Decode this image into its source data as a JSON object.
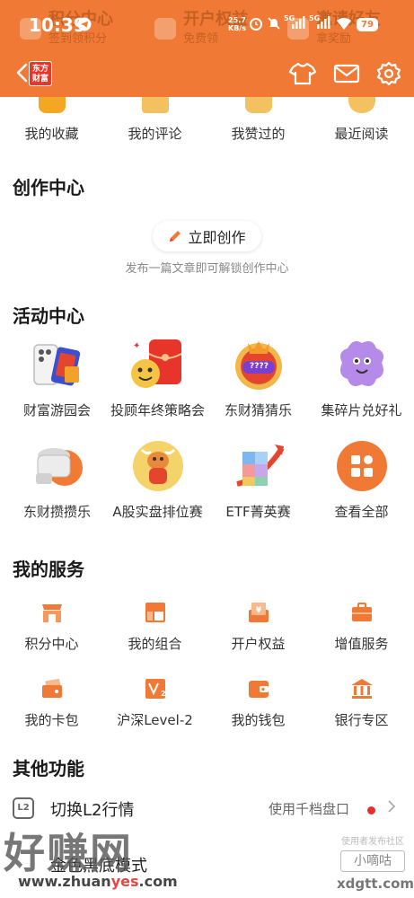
{
  "header": {
    "ghost": [
      {
        "title": "积分中心",
        "sub": "签到领积分"
      },
      {
        "title": "开户权益",
        "sub": "免费领"
      },
      {
        "title": "邀请好友",
        "sub": "拿奖励"
      }
    ],
    "status": {
      "time": "10:39",
      "speed_top": "25.7",
      "speed_bottom": "KB/s",
      "network_1": "5G",
      "network_2": "5G",
      "battery": "79"
    },
    "logo_text_1": "东方",
    "logo_text_2": "财富",
    "accent_color": "#f07a35"
  },
  "quick": [
    {
      "label": "我的收藏",
      "icon": "star-icon"
    },
    {
      "label": "我的评论",
      "icon": "comment-icon"
    },
    {
      "label": "我赞过的",
      "icon": "thumb-up-icon"
    },
    {
      "label": "最近阅读",
      "icon": "clock-icon"
    }
  ],
  "creation": {
    "title": "创作中心",
    "button": "立即创作",
    "note": "发布一篇文章即可解锁创作中心"
  },
  "activities": {
    "title": "活动中心",
    "items": [
      {
        "label": "财富游园会"
      },
      {
        "label": "投顾年终策略会"
      },
      {
        "label": "东财猜猜乐",
        "badge": "????"
      },
      {
        "label": "集碎片兑好礼"
      },
      {
        "label": "东财攒攒乐"
      },
      {
        "label": "A股实盘排位赛"
      },
      {
        "label": "ETF菁英赛"
      },
      {
        "label": "查看全部"
      }
    ]
  },
  "services": {
    "title": "我的服务",
    "items": [
      {
        "label": "积分中心",
        "icon": "shop-icon"
      },
      {
        "label": "我的组合",
        "icon": "portfolio-icon"
      },
      {
        "label": "开户权益",
        "icon": "yen-voucher-icon"
      },
      {
        "label": "增值服务",
        "icon": "briefcase-icon"
      },
      {
        "label": "我的卡包",
        "icon": "card-wallet-icon"
      },
      {
        "label": "沪深Level-2",
        "icon": "level2-icon"
      },
      {
        "label": "我的钱包",
        "icon": "wallet-icon"
      },
      {
        "label": "银行专区",
        "icon": "bank-icon"
      }
    ]
  },
  "other": {
    "title": "其他功能",
    "l2_label": "切换L2行情",
    "l2_icon_text": "L2",
    "l2_value": "使用千档盘口",
    "dark_label": "金色黑底模式"
  },
  "watermark": {
    "big": "好赚网",
    "url_a": "www.zhuan",
    "url_b": "yes",
    "url_c": ".com",
    "right_top": "使用者发布社区",
    "right_box": "小嘀咕",
    "right_url": "xdgtt.com"
  }
}
